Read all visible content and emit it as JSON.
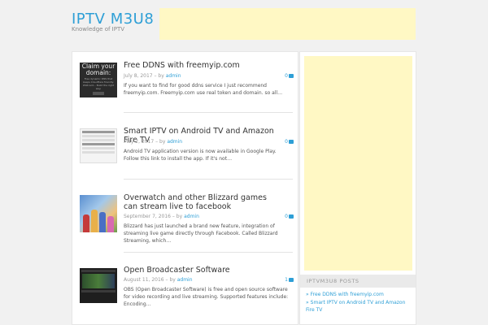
{
  "site": {
    "title": "IPTV M3U8",
    "description": "Knowledge of IPTV"
  },
  "colors": {
    "accent": "#2e9fd6",
    "ad_placeholder": "#fff8c4",
    "background": "#f1f1f1"
  },
  "posts": [
    {
      "title": "Free DDNS with freemyip.com",
      "date": "July 8, 2017",
      "by": " – by ",
      "author": "admin",
      "comments": "0",
      "excerpt": "If you want to find for good ddns service I just recommend freemyip.com. Freemyip.com use real token and domain. so all…",
      "thumb": {
        "heading": "Claim your domain:",
        "body": "Free dynamic DNS that keeps Cloudflare friendly. Wildcard... Build the right way."
      }
    },
    {
      "title": "Smart IPTV on Android TV and Amazon Fire TV",
      "date": "May 2, 2017",
      "by": " – by ",
      "author": "admin",
      "comments": "0",
      "excerpt": "Android TV application version is now available in Google Play. Follow this link to install the app. If it's not…"
    },
    {
      "title": "Overwatch and other Blizzard games can stream live to facebook",
      "date": "September 7, 2016",
      "by": " – by ",
      "author": "admin",
      "comments": "0",
      "excerpt": "Blizzard has just launched a brand new feature, integration of streaming live game directly through Facebook. Called Blizzard Streaming, which…"
    },
    {
      "title": "Open Broadcaster Software",
      "date": "August 11, 2016",
      "by": " – by ",
      "author": "admin",
      "comments": "1",
      "excerpt": "OBS (Open Broadcaster Software) is free and open source software for video recording and live streaming. Supported features include: Encoding…"
    }
  ],
  "sidebar": {
    "widget_title": "IPTVM3U8 POSTS",
    "arrow": "»",
    "items": [
      "Free DDNS with freemyip.com",
      "Smart IPTV on Android TV and Amazon Fire TV"
    ]
  }
}
